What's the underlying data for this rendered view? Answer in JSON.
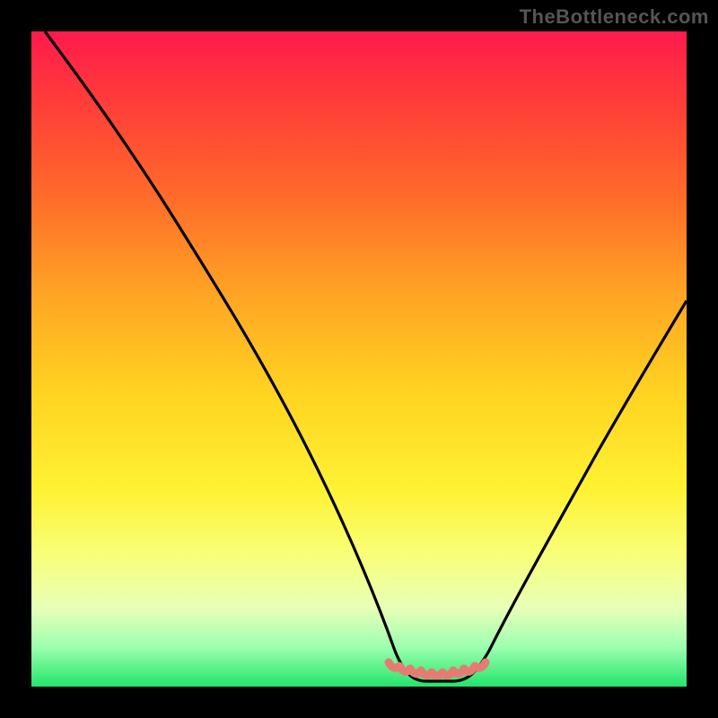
{
  "watermark": "TheBottleneck.com",
  "chart_data": {
    "type": "line",
    "title": "",
    "xlabel": "",
    "ylabel": "",
    "xlim": [
      0,
      100
    ],
    "ylim": [
      0,
      100
    ],
    "series": [
      {
        "name": "bottleneck-curve",
        "x": [
          2,
          8,
          15,
          22,
          30,
          38,
          46,
          52,
          55,
          57,
          59,
          61,
          63,
          65,
          68,
          74,
          82,
          90,
          100
        ],
        "y": [
          100,
          92,
          82,
          72,
          60,
          48,
          32,
          14,
          4,
          1,
          0.5,
          0.5,
          1,
          3,
          10,
          22,
          38,
          50,
          60
        ]
      },
      {
        "name": "target-zone",
        "x": [
          54,
          56,
          58,
          60,
          62,
          64,
          66
        ],
        "y": [
          4,
          2,
          1,
          1,
          1,
          2,
          4
        ]
      }
    ],
    "gradient_stops": [
      {
        "pos": 0,
        "color": "#ff1a4d"
      },
      {
        "pos": 25,
        "color": "#ff6a2a"
      },
      {
        "pos": 55,
        "color": "#ffd321"
      },
      {
        "pos": 80,
        "color": "#f8ff7a"
      },
      {
        "pos": 100,
        "color": "#22e56a"
      }
    ],
    "colors": {
      "curve": "#000000",
      "target_zone": "#e77b74",
      "background": "#000000"
    }
  }
}
